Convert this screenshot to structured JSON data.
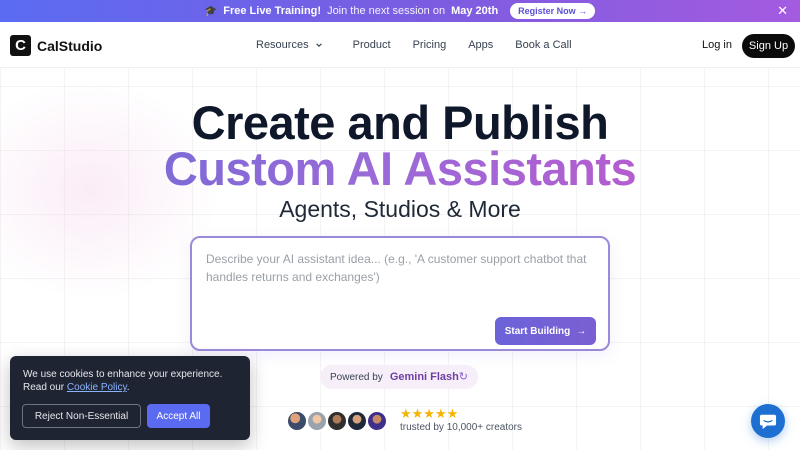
{
  "announcement": {
    "icon": "graduation-cap-icon",
    "bold_text": "Free Live Training!",
    "text": "Join the next session on",
    "date": "May 20th",
    "register_label": "Register Now →",
    "close_label": "✕"
  },
  "nav": {
    "logo_mark": "C",
    "logo_text": "CalStudio",
    "links": [
      "Resources",
      "Product",
      "Pricing",
      "Apps",
      "Book a Call"
    ],
    "resources_chevron": "chevron-down-icon",
    "login_label": "Log in",
    "signup_label": "Sign Up"
  },
  "hero": {
    "line1": "Create and Publish",
    "line2": "Custom AI Assistants",
    "line3": "Agents, Studios & More"
  },
  "prompt": {
    "placeholder": "Describe your AI assistant idea... (e.g., 'A customer support chatbot that handles returns and exchanges')",
    "button_label": "Start Building",
    "button_arrow": "→"
  },
  "powered": {
    "label": "Powered by",
    "model": "Gemini Flash",
    "refresh_icon": "↻"
  },
  "social_proof": {
    "stars": "★★★★★",
    "text": "trusted by 10,000+ creators"
  },
  "cookie_banner": {
    "text": "We use cookies to enhance your experience. Read our",
    "link": "Cookie Policy",
    "suffix": ".",
    "reject_label": "Reject Non-Essential",
    "accept_label": "Accept All"
  },
  "colors": {
    "accent": "#7c5ce0",
    "announcement_gradient_start": "#5b6cf2",
    "announcement_gradient_end": "#a45be0",
    "chat_button": "#1d6fd1",
    "star": "#f5b400"
  }
}
